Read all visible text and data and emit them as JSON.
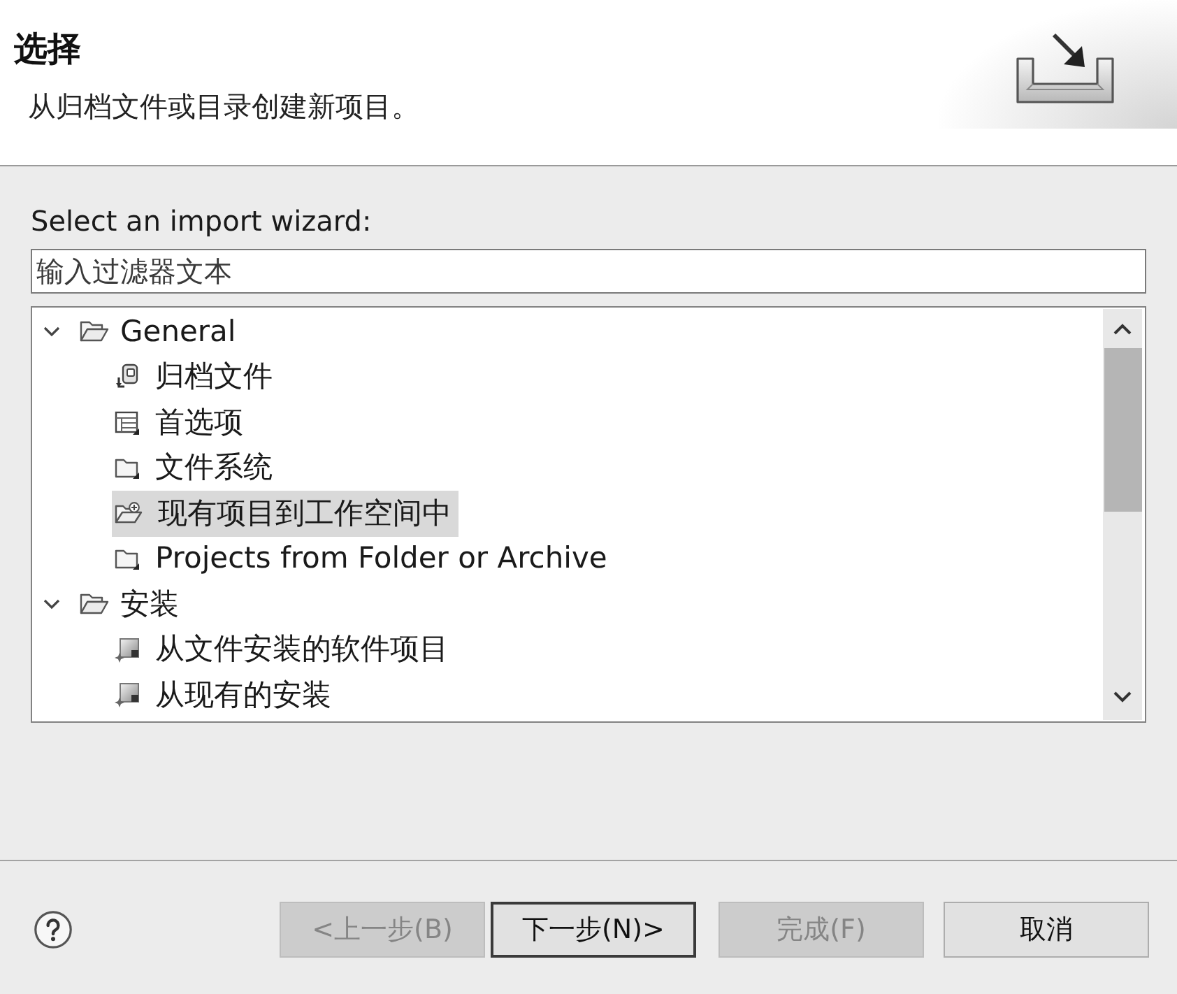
{
  "header": {
    "title": "选择",
    "description": "从归档文件或目录创建新项目。"
  },
  "wizard_label": "Select an import wizard:",
  "filter": {
    "placeholder": "输入过滤器文本"
  },
  "tree": [
    {
      "label": "General",
      "expanded": true,
      "selected": false,
      "children": [
        {
          "label": "归档文件",
          "kind": "archive",
          "selected": false
        },
        {
          "label": "首选项",
          "kind": "preferences",
          "selected": false
        },
        {
          "label": "文件系统",
          "kind": "folder",
          "selected": false
        },
        {
          "label": "现有项目到工作空间中",
          "kind": "import-folder",
          "selected": true
        },
        {
          "label": "Projects from Folder or Archive",
          "kind": "folder",
          "selected": false
        }
      ]
    },
    {
      "label": "安装",
      "expanded": true,
      "selected": false,
      "children": [
        {
          "label": "从文件安装的软件项目",
          "kind": "install",
          "selected": false
        },
        {
          "label": "从现有的安装",
          "kind": "install",
          "selected": false
        }
      ]
    }
  ],
  "buttons": [
    {
      "label": "<上一步(B)",
      "disabled": true,
      "default": false
    },
    {
      "label": "下一步(N)>",
      "disabled": false,
      "default": true
    },
    {
      "label": "完成(F)",
      "disabled": true,
      "default": false
    },
    {
      "label": "取消",
      "disabled": false,
      "default": false
    }
  ]
}
